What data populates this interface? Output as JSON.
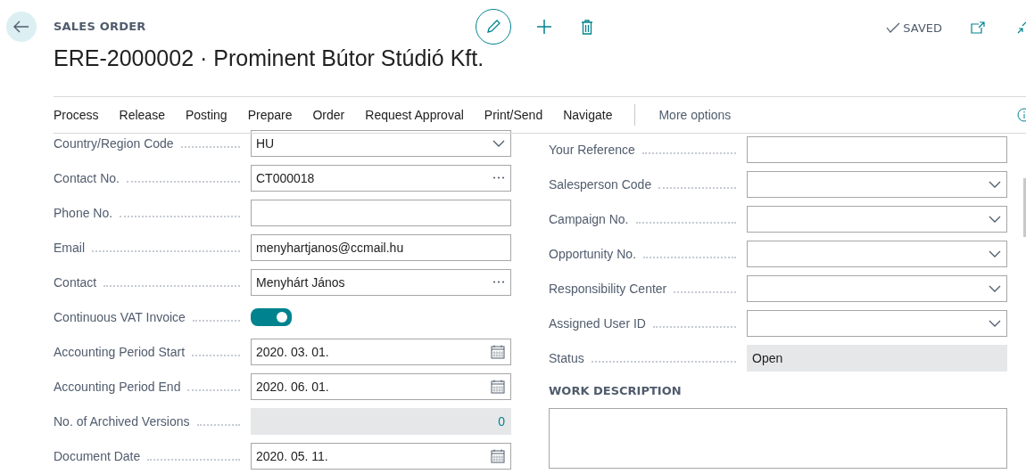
{
  "header": {
    "caption": "SALES ORDER",
    "title": "ERE-2000002 · Prominent Bútor Stúdió Kft.",
    "status": "SAVED"
  },
  "actions": [
    {
      "label": "Process"
    },
    {
      "label": "Release"
    },
    {
      "label": "Posting"
    },
    {
      "label": "Prepare"
    },
    {
      "label": "Order"
    },
    {
      "label": "Request Approval"
    },
    {
      "label": "Print/Send"
    },
    {
      "label": "Navigate"
    }
  ],
  "more_options": "More options",
  "left_fields": [
    {
      "label": "Country/Region Code",
      "kind": "dropdown",
      "value": "HU"
    },
    {
      "label": "Contact No.",
      "kind": "lookup",
      "value": "CT000018"
    },
    {
      "label": "Phone No.",
      "kind": "text"
    },
    {
      "label": "Email",
      "kind": "text",
      "value": "menyhartjanos@ccmail.hu"
    },
    {
      "label": "Contact",
      "kind": "lookup",
      "value": "Menyhárt János"
    },
    {
      "label": "Continuous VAT Invoice",
      "kind": "toggle",
      "on": true
    },
    {
      "label": "Accounting Period Start",
      "kind": "date",
      "value": "2020. 03. 01."
    },
    {
      "label": "Accounting Period End",
      "kind": "date",
      "value": "2020. 06. 01."
    },
    {
      "label": "No. of Archived Versions",
      "kind": "readonly_number",
      "value": "0"
    },
    {
      "label": "Document Date",
      "kind": "date",
      "value": "2020. 05. 11."
    }
  ],
  "right_fields": [
    {
      "label": "Your Reference",
      "kind": "text"
    },
    {
      "label": "Salesperson Code",
      "kind": "dropdown"
    },
    {
      "label": "Campaign No.",
      "kind": "dropdown"
    },
    {
      "label": "Opportunity No.",
      "kind": "dropdown"
    },
    {
      "label": "Responsibility Center",
      "kind": "dropdown"
    },
    {
      "label": "Assigned User ID",
      "kind": "dropdown"
    },
    {
      "label": "Status",
      "kind": "readonly_text",
      "value": "Open"
    }
  ],
  "work_description": {
    "heading": "WORK DESCRIPTION"
  }
}
